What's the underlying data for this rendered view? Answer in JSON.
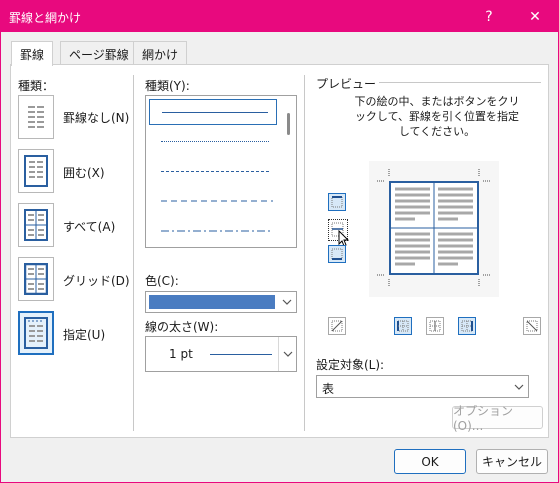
{
  "window": {
    "title": "罫線と網かけ",
    "help_label": "?",
    "close_label": "✕",
    "accent_color": "#e8097e"
  },
  "tabs": [
    {
      "label": "罫線"
    },
    {
      "label": "ページ罫線"
    },
    {
      "label": "網かけ"
    }
  ],
  "settings": {
    "heading": "種類：",
    "items": [
      {
        "label": "罫線なし(N)",
        "icon": "no-border-icon"
      },
      {
        "label": "囲む(X)",
        "icon": "box-border-icon"
      },
      {
        "label": "すべて(A)",
        "icon": "all-borders-icon"
      },
      {
        "label": "グリッド(D)",
        "icon": "grid-border-icon"
      },
      {
        "label": "指定(U)",
        "icon": "custom-border-icon"
      }
    ],
    "selected": "指定(U)"
  },
  "style": {
    "heading": "種類(Y):",
    "selected_index": 0
  },
  "color": {
    "label": "色(C):",
    "value": "#4a7cc1"
  },
  "width": {
    "label": "線の太さ(W):",
    "value": "1 pt"
  },
  "preview": {
    "heading": "プレビュー",
    "instruction": "下の絵の中、またはボタンをクリックして、罫線を引く位置を指定してください。"
  },
  "apply_to": {
    "label": "設定対象(L):",
    "value": "表"
  },
  "buttons": {
    "options": "オプション(O)...",
    "ok": "OK",
    "cancel": "キャンセル"
  }
}
